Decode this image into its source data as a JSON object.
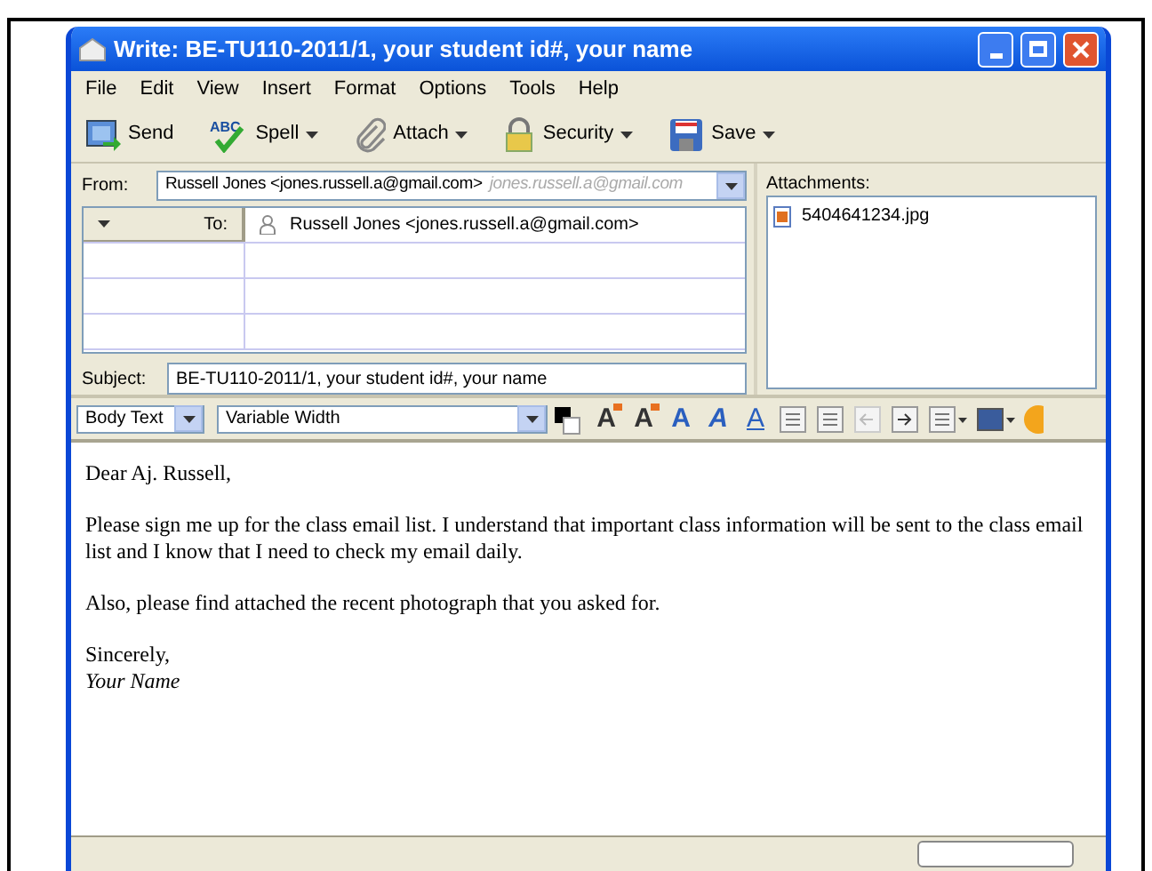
{
  "window": {
    "title": "Write: BE-TU110-2011/1, your student id#, your name"
  },
  "menu": [
    "File",
    "Edit",
    "View",
    "Insert",
    "Format",
    "Options",
    "Tools",
    "Help"
  ],
  "toolbar": [
    {
      "kind": "send",
      "label": "Send",
      "dropdown": false
    },
    {
      "kind": "spell",
      "label": "Spell",
      "dropdown": true,
      "icon_text": "ABC"
    },
    {
      "kind": "attach",
      "label": "Attach",
      "dropdown": true
    },
    {
      "kind": "security",
      "label": "Security",
      "dropdown": true
    },
    {
      "kind": "save",
      "label": "Save",
      "dropdown": true
    }
  ],
  "from": {
    "label": "From:",
    "value": "Russell Jones <jones.russell.a@gmail.com>",
    "hint": "jones.russell.a@gmail.com"
  },
  "recipients": [
    {
      "type": "To:",
      "value": "Russell Jones <jones.russell.a@gmail.com>"
    }
  ],
  "subject": {
    "label": "Subject:",
    "value": "BE-TU110-2011/1, your student id#, your name"
  },
  "attachments": {
    "label": "Attachments:",
    "files": [
      "5404641234.jpg"
    ]
  },
  "format_bar": {
    "paragraph_style": "Body Text",
    "font": "Variable Width",
    "glyph_buttons": [
      {
        "kind": "larger",
        "glyph": "A"
      },
      {
        "kind": "smaller",
        "glyph": "A"
      },
      {
        "kind": "bold",
        "glyph": "A"
      },
      {
        "kind": "italic",
        "glyph": "A"
      },
      {
        "kind": "underline",
        "glyph": "A"
      }
    ]
  },
  "body": [
    {
      "kind": "text",
      "text": "Dear Aj. Russell,"
    },
    {
      "kind": "text",
      "text": "Please sign me up for the class email list.  I understand that important class information will be sent to the class email list and I know that I need to check my email daily."
    },
    {
      "kind": "text",
      "text": "Also, please find attached the recent photograph that you asked for."
    },
    {
      "kind": "text",
      "text": "Sincerely,"
    },
    {
      "kind": "italic",
      "text": "Your Name"
    }
  ]
}
